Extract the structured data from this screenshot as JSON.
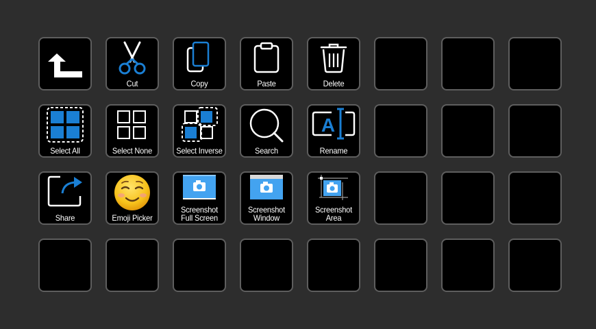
{
  "keys": [
    {
      "label": "",
      "icon": "back-arrow-icon"
    },
    {
      "label": "Cut",
      "icon": "scissors-icon"
    },
    {
      "label": "Copy",
      "icon": "copy-icon"
    },
    {
      "label": "Paste",
      "icon": "clipboard-icon"
    },
    {
      "label": "Delete",
      "icon": "trash-icon"
    },
    {
      "label": "Select All",
      "icon": "select-all-icon"
    },
    {
      "label": "Select None",
      "icon": "select-none-icon"
    },
    {
      "label": "Select Inverse",
      "icon": "select-inverse-icon"
    },
    {
      "label": "Search",
      "icon": "magnifier-icon"
    },
    {
      "label": "Rename",
      "icon": "rename-icon"
    },
    {
      "label": "Share",
      "icon": "share-icon"
    },
    {
      "label": "Emoji Picker",
      "icon": "smiling-face-icon"
    },
    {
      "label_line1": "Screenshot",
      "label_line2": "Full Screen",
      "icon": "screenshot-full-icon"
    },
    {
      "label_line1": "Screenshot",
      "label_line2": "Window",
      "icon": "screenshot-window-icon"
    },
    {
      "label_line1": "Screenshot",
      "label_line2": "Area",
      "icon": "screenshot-area-icon"
    }
  ],
  "colors": {
    "background": "#2d2d2d",
    "key": "#000000",
    "key_border": "#5e5e5e",
    "accent_blue": "#1a7fd4",
    "light_blue": "#43a3f0",
    "white": "#ffffff"
  }
}
